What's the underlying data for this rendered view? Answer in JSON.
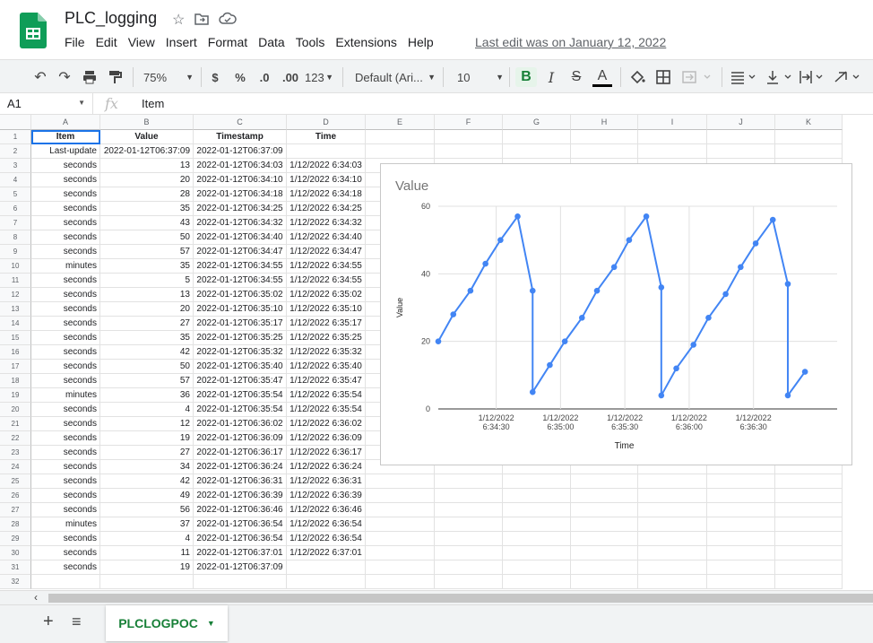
{
  "doc": {
    "title": "PLC_logging",
    "last_edit": "Last edit was on January 12, 2022"
  },
  "menu": [
    "File",
    "Edit",
    "View",
    "Insert",
    "Format",
    "Data",
    "Tools",
    "Extensions",
    "Help"
  ],
  "toolbar": {
    "zoom": "75%",
    "currency": "$",
    "percent": "%",
    "dec_less": ".0",
    "dec_more": ".00",
    "format_more": "123",
    "font": "Default (Ari...",
    "font_size": "10",
    "bold": "B",
    "italic": "I",
    "strike": "S",
    "text_color": "A"
  },
  "formula_bar": {
    "cell": "A1",
    "fx": "fx",
    "content": "Item"
  },
  "columns": [
    "A",
    "B",
    "C",
    "D",
    "E",
    "F",
    "G",
    "H",
    "I",
    "J",
    "K"
  ],
  "headers": [
    "Item",
    "Value",
    "Timestamp",
    "Time"
  ],
  "rows": [
    [
      "Last-update",
      "2022-01-12T06:37:09",
      "2022-01-12T06:37:09",
      ""
    ],
    [
      "seconds",
      "13",
      "2022-01-12T06:34:03",
      "1/12/2022 6:34:03"
    ],
    [
      "seconds",
      "20",
      "2022-01-12T06:34:10",
      "1/12/2022 6:34:10"
    ],
    [
      "seconds",
      "28",
      "2022-01-12T06:34:18",
      "1/12/2022 6:34:18"
    ],
    [
      "seconds",
      "35",
      "2022-01-12T06:34:25",
      "1/12/2022 6:34:25"
    ],
    [
      "seconds",
      "43",
      "2022-01-12T06:34:32",
      "1/12/2022 6:34:32"
    ],
    [
      "seconds",
      "50",
      "2022-01-12T06:34:40",
      "1/12/2022 6:34:40"
    ],
    [
      "seconds",
      "57",
      "2022-01-12T06:34:47",
      "1/12/2022 6:34:47"
    ],
    [
      "minutes",
      "35",
      "2022-01-12T06:34:55",
      "1/12/2022 6:34:55"
    ],
    [
      "seconds",
      "5",
      "2022-01-12T06:34:55",
      "1/12/2022 6:34:55"
    ],
    [
      "seconds",
      "13",
      "2022-01-12T06:35:02",
      "1/12/2022 6:35:02"
    ],
    [
      "seconds",
      "20",
      "2022-01-12T06:35:10",
      "1/12/2022 6:35:10"
    ],
    [
      "seconds",
      "27",
      "2022-01-12T06:35:17",
      "1/12/2022 6:35:17"
    ],
    [
      "seconds",
      "35",
      "2022-01-12T06:35:25",
      "1/12/2022 6:35:25"
    ],
    [
      "seconds",
      "42",
      "2022-01-12T06:35:32",
      "1/12/2022 6:35:32"
    ],
    [
      "seconds",
      "50",
      "2022-01-12T06:35:40",
      "1/12/2022 6:35:40"
    ],
    [
      "seconds",
      "57",
      "2022-01-12T06:35:47",
      "1/12/2022 6:35:47"
    ],
    [
      "minutes",
      "36",
      "2022-01-12T06:35:54",
      "1/12/2022 6:35:54"
    ],
    [
      "seconds",
      "4",
      "2022-01-12T06:35:54",
      "1/12/2022 6:35:54"
    ],
    [
      "seconds",
      "12",
      "2022-01-12T06:36:02",
      "1/12/2022 6:36:02"
    ],
    [
      "seconds",
      "19",
      "2022-01-12T06:36:09",
      "1/12/2022 6:36:09"
    ],
    [
      "seconds",
      "27",
      "2022-01-12T06:36:17",
      "1/12/2022 6:36:17"
    ],
    [
      "seconds",
      "34",
      "2022-01-12T06:36:24",
      "1/12/2022 6:36:24"
    ],
    [
      "seconds",
      "42",
      "2022-01-12T06:36:31",
      "1/12/2022 6:36:31"
    ],
    [
      "seconds",
      "49",
      "2022-01-12T06:36:39",
      "1/12/2022 6:36:39"
    ],
    [
      "seconds",
      "56",
      "2022-01-12T06:36:46",
      "1/12/2022 6:36:46"
    ],
    [
      "minutes",
      "37",
      "2022-01-12T06:36:54",
      "1/12/2022 6:36:54"
    ],
    [
      "seconds",
      "4",
      "2022-01-12T06:36:54",
      "1/12/2022 6:36:54"
    ],
    [
      "seconds",
      "11",
      "2022-01-12T06:37:01",
      "1/12/2022 6:37:01"
    ],
    [
      "seconds",
      "19",
      "2022-01-12T06:37:09",
      ""
    ]
  ],
  "chart_data": {
    "type": "line",
    "title": "Value",
    "xlabel": "Time",
    "ylabel": "Value",
    "ylim": [
      0,
      60
    ],
    "yticks": [
      0,
      20,
      40,
      60
    ],
    "xticks": [
      {
        "date": "1/12/2022",
        "time": "6:34:30",
        "t": "06:34:30"
      },
      {
        "date": "1/12/2022",
        "time": "6:35:00",
        "t": "06:35:00"
      },
      {
        "date": "1/12/2022",
        "time": "6:35:30",
        "t": "06:35:30"
      },
      {
        "date": "1/12/2022",
        "time": "6:36:00",
        "t": "06:36:00"
      },
      {
        "date": "1/12/2022",
        "time": "6:36:30",
        "t": "06:36:30"
      }
    ],
    "xlim": [
      "06:34:03",
      "06:37:09"
    ],
    "grid": true,
    "color": "#4285f4",
    "points": [
      {
        "t": "06:34:03",
        "v": 20
      },
      {
        "t": "06:34:10",
        "v": 28
      },
      {
        "t": "06:34:18",
        "v": 35
      },
      {
        "t": "06:34:25",
        "v": 43
      },
      {
        "t": "06:34:32",
        "v": 50
      },
      {
        "t": "06:34:40",
        "v": 57
      },
      {
        "t": "06:34:47",
        "v": 35
      },
      {
        "t": "06:34:47",
        "v": 5
      },
      {
        "t": "06:34:55",
        "v": 13
      },
      {
        "t": "06:35:02",
        "v": 20
      },
      {
        "t": "06:35:10",
        "v": 27
      },
      {
        "t": "06:35:17",
        "v": 35
      },
      {
        "t": "06:35:25",
        "v": 42
      },
      {
        "t": "06:35:32",
        "v": 50
      },
      {
        "t": "06:35:40",
        "v": 57
      },
      {
        "t": "06:35:47",
        "v": 36
      },
      {
        "t": "06:35:47",
        "v": 4
      },
      {
        "t": "06:35:54",
        "v": 12
      },
      {
        "t": "06:36:02",
        "v": 19
      },
      {
        "t": "06:36:09",
        "v": 27
      },
      {
        "t": "06:36:17",
        "v": 34
      },
      {
        "t": "06:36:24",
        "v": 42
      },
      {
        "t": "06:36:31",
        "v": 49
      },
      {
        "t": "06:36:39",
        "v": 56
      },
      {
        "t": "06:36:46",
        "v": 37
      },
      {
        "t": "06:36:46",
        "v": 4
      },
      {
        "t": "06:36:54",
        "v": 11
      }
    ]
  },
  "sheet_tab": {
    "name": "PLCLOGPOC"
  }
}
